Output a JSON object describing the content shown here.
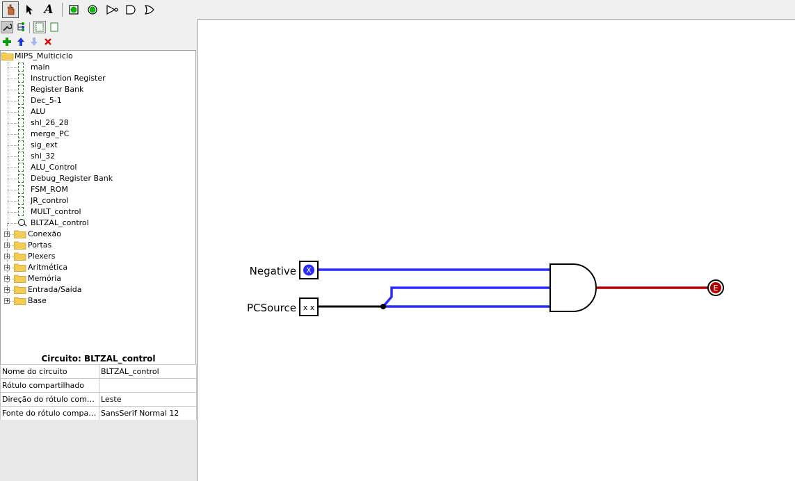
{
  "toolbar": {
    "tools": [
      {
        "name": "poke-tool-icon"
      },
      {
        "name": "select-tool-icon"
      },
      {
        "name": "text-tool-icon",
        "glyph": "A"
      },
      {
        "name": "input-pin-icon"
      },
      {
        "name": "output-pin-icon"
      },
      {
        "name": "not-gate-icon"
      },
      {
        "name": "and-gate-icon"
      },
      {
        "name": "or-gate-icon"
      }
    ]
  },
  "explorer": {
    "project_name": "MIPS_Multiciclo",
    "circuits": [
      "main",
      "Instruction Register",
      "Register Bank",
      "Dec_5-1",
      "ALU",
      "shl_26_28",
      "merge_PC",
      "sig_ext",
      "shl_32",
      "ALU_Control",
      "Debug_Register Bank",
      "FSM_ROM",
      "JR_control",
      "MULT_control",
      "BLTZAL_control"
    ],
    "libraries": [
      "Conexão",
      "Portas",
      "Plexers",
      "Aritmética",
      "Memória",
      "Entrada/Saída",
      "Base"
    ]
  },
  "attributes": {
    "title": "Circuito: BLTZAL_control",
    "rows": [
      {
        "key": "Nome do circuito",
        "value": "BLTZAL_control"
      },
      {
        "key": "Rótulo compartilhado",
        "value": ""
      },
      {
        "key": "Direção do rótulo compartilhado",
        "value": "Leste"
      },
      {
        "key": "Fonte do rótulo compartilhado",
        "value": "SansSerif Normal 12"
      }
    ]
  },
  "canvas": {
    "inputs": [
      {
        "label": "Negative",
        "state": "X"
      },
      {
        "label": "PCSource",
        "state": "x x"
      }
    ],
    "output": {
      "state": "E"
    },
    "colors": {
      "wire_unknown": "#2b2bff",
      "wire_error": "#b20000",
      "wire_off": "#000000"
    }
  }
}
